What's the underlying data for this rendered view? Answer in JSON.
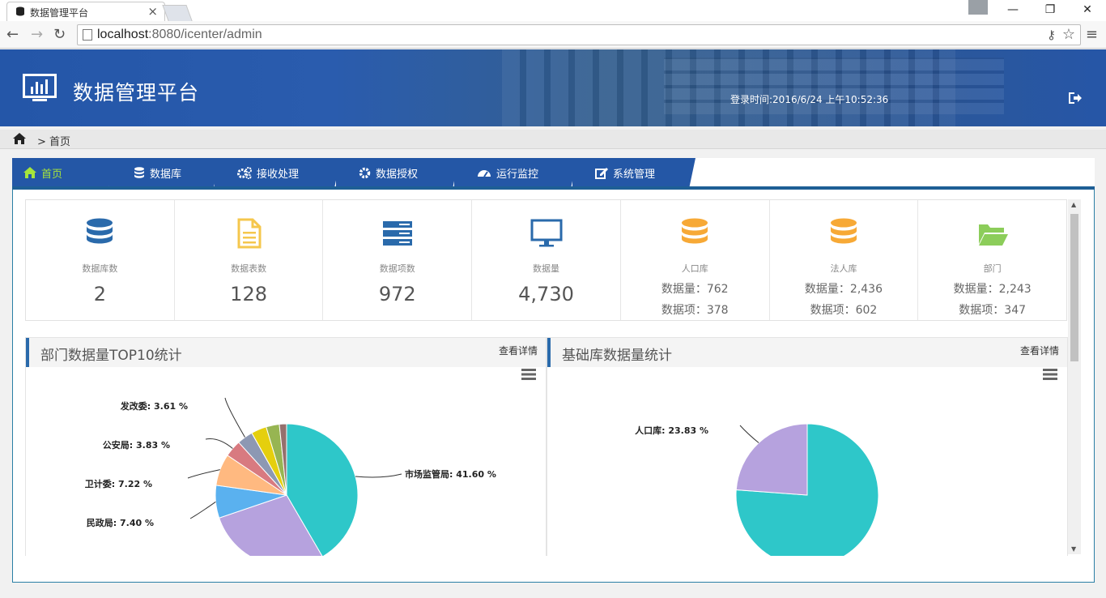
{
  "browser": {
    "tab_title": "数据管理平台",
    "url_host": "localhost",
    "url_rest": ":8080/icenter/admin"
  },
  "header": {
    "title": "数据管理平台",
    "login_time": "登录时间:2016/6/24 上午10:52:36"
  },
  "breadcrumb": {
    "text": "> 首页"
  },
  "nav": {
    "tabs": [
      {
        "label": "首页",
        "icon": "home-icon"
      },
      {
        "label": "数据库",
        "icon": "database-icon"
      },
      {
        "label": "接收处理",
        "icon": "cogs-icon"
      },
      {
        "label": "数据授权",
        "icon": "gear-icon"
      },
      {
        "label": "运行监控",
        "icon": "dashboard-icon"
      },
      {
        "label": "系统管理",
        "icon": "edit-icon"
      }
    ]
  },
  "stats": [
    {
      "label": "数据库数",
      "value": "2",
      "icon": "database-icon",
      "color": "#2a6aab"
    },
    {
      "label": "数据表数",
      "value": "128",
      "icon": "document-icon",
      "color": "#f5c74d"
    },
    {
      "label": "数据项数",
      "value": "972",
      "icon": "server-icon",
      "color": "#2a6aab"
    },
    {
      "label": "数据量",
      "value": "4,730",
      "icon": "monitor-icon",
      "color": "#2a6aab"
    },
    {
      "label": "人口库",
      "line1": "数据量：762",
      "line2": "数据项：378",
      "icon": "database-icon",
      "color": "#f7a936"
    },
    {
      "label": "法人库",
      "line1": "数据量：2,436",
      "line2": "数据项：602",
      "icon": "database-icon",
      "color": "#f7a936"
    },
    {
      "label": "部门",
      "line1": "数据量：2,243",
      "line2": "数据项：347",
      "icon": "folder-open-icon",
      "color": "#8ccd5a"
    }
  ],
  "panels": {
    "dept": {
      "title": "部门数据量TOP10统计",
      "more": "查看详情"
    },
    "base": {
      "title": "基础库数据量统计",
      "more": "查看详情"
    }
  },
  "chart_data": [
    {
      "type": "pie",
      "title": "部门数据量TOP10统计",
      "slices": [
        {
          "name": "市场监管局",
          "value": 41.6,
          "label": "市场监管局: 41.60 %",
          "color": "#2ec7c9"
        },
        {
          "name": "",
          "value": 28.2,
          "label": "",
          "color": "#b6a2de"
        },
        {
          "name": "民政局",
          "value": 7.4,
          "label": "民政局: 7.40 %",
          "color": "#5ab1ef"
        },
        {
          "name": "卫计委",
          "value": 7.22,
          "label": "卫计委: 7.22 %",
          "color": "#ffb980"
        },
        {
          "name": "公安局",
          "value": 3.83,
          "label": "公安局: 3.83 %",
          "color": "#d87a80"
        },
        {
          "name": "发改委",
          "value": 3.61,
          "label": "发改委: 3.61 %",
          "color": "#8d98b3"
        },
        {
          "name": "",
          "value": 3.5,
          "label": "",
          "color": "#e5cf0d"
        },
        {
          "name": "",
          "value": 3.0,
          "label": "",
          "color": "#97b552"
        },
        {
          "name": "",
          "value": 1.64,
          "label": "",
          "color": "#95706d"
        }
      ]
    },
    {
      "type": "pie",
      "title": "基础库数据量统计",
      "slices": [
        {
          "name": "",
          "value": 76.17,
          "label": "",
          "color": "#2ec7c9"
        },
        {
          "name": "人口库",
          "value": 23.83,
          "label": "人口库: 23.83 %",
          "color": "#b6a2de"
        }
      ]
    }
  ]
}
